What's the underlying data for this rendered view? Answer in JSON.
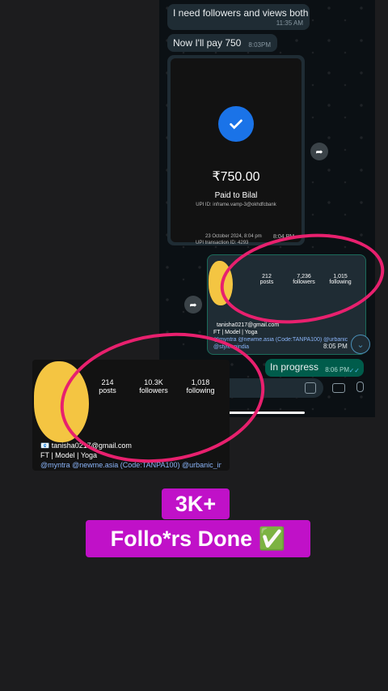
{
  "messages": [
    {
      "text": "I need followers and views both",
      "time": "11:35 AM"
    },
    {
      "text": "Now I'll pay 750",
      "time": "8:03PM"
    }
  ],
  "receipt": {
    "amount": "₹750.00",
    "paid_to": "Paid to Bilal",
    "upi_id": "UPI ID: inframe.vamp-3@okhdfcbank",
    "date": "23 October 2024, 8:04 pm",
    "time": "8:04 PM",
    "txn": "UPI transaction ID: 4293"
  },
  "ig_chat": {
    "posts": "212",
    "posts_label": "posts",
    "followers": "7,236",
    "followers_label": "followers",
    "following": "1,015",
    "following_label": "following",
    "email": "tanisha0217@gmail.com",
    "bio": "FT | Model | Yoga",
    "tags": "@myntra @newme.asia (Code:TANPA100) @urbanic",
    "extra": "@styleupindia",
    "time": "8:05 PM"
  },
  "progress": {
    "text": "In progress",
    "time": "8:06 PM"
  },
  "ig_overlay": {
    "posts": "214",
    "posts_label": "posts",
    "followers": "10.3K",
    "followers_label": "followers",
    "following": "1,018",
    "following_label": "following",
    "email": "📧 tanisha0217@gmail.com",
    "bio": "FT | Model | Yoga",
    "tags": "@myntra @newme.asia (Code:TANPA100) @urbanic_in"
  },
  "caption": {
    "line1": "3K+",
    "line2": "Follo*rs Done ✅"
  },
  "colors": {
    "accent_ring": "#e8206e",
    "caption_bg": "#c011c8",
    "wa_green": "#005c4b",
    "gpay_blue": "#1a73e8"
  }
}
